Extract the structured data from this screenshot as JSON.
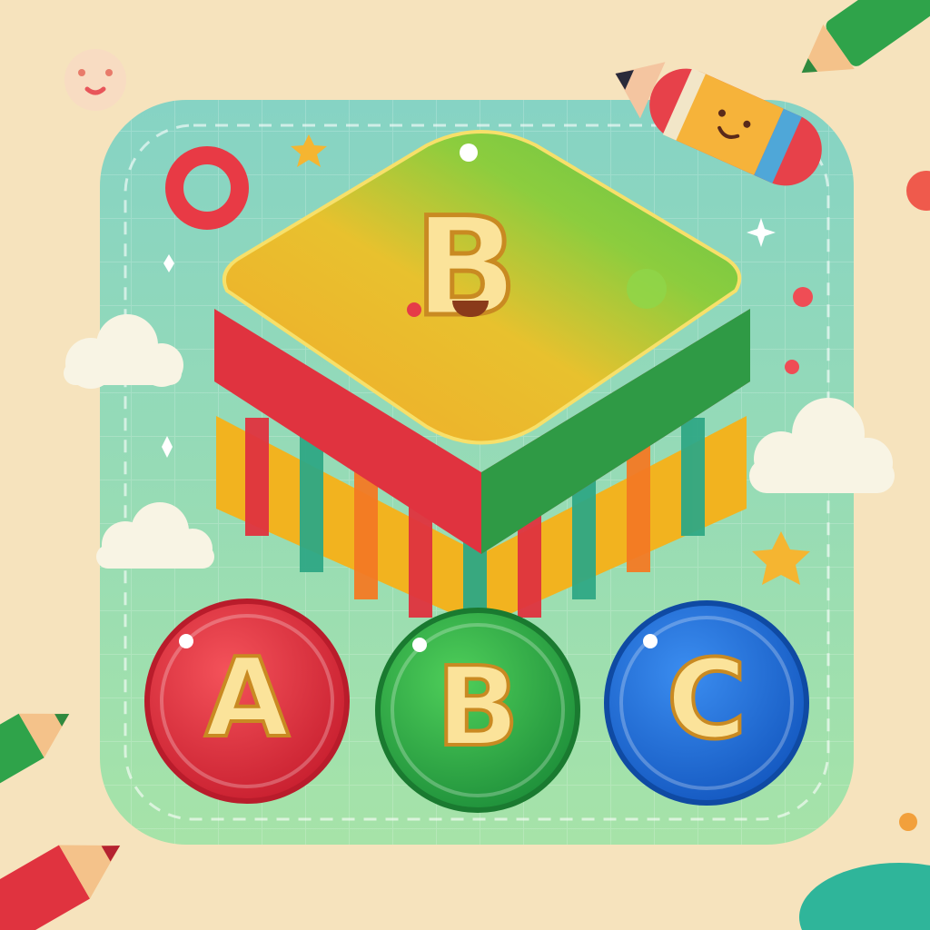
{
  "colors": {
    "background": "#f6e3bd",
    "card": "#8fd9c0",
    "block_top_green": "#74c940",
    "block_top_yellow": "#f3b52a",
    "block_side_red": "#e0333f",
    "block_side_green": "#2f9a45",
    "letter_fill": "#fbe39a",
    "button_a": "#e3303e",
    "button_b": "#2fae4a",
    "button_c": "#1e6fd6"
  },
  "icons": [
    "face-bubble-icon",
    "ring-icon",
    "star-icon",
    "sparkle-icon",
    "cloud-icon",
    "pencil-icon",
    "crayon-character-icon",
    "dot-icon"
  ],
  "block": {
    "letter": "B"
  },
  "buttons": [
    {
      "letter": "A"
    },
    {
      "letter": "B"
    },
    {
      "letter": "C"
    }
  ]
}
